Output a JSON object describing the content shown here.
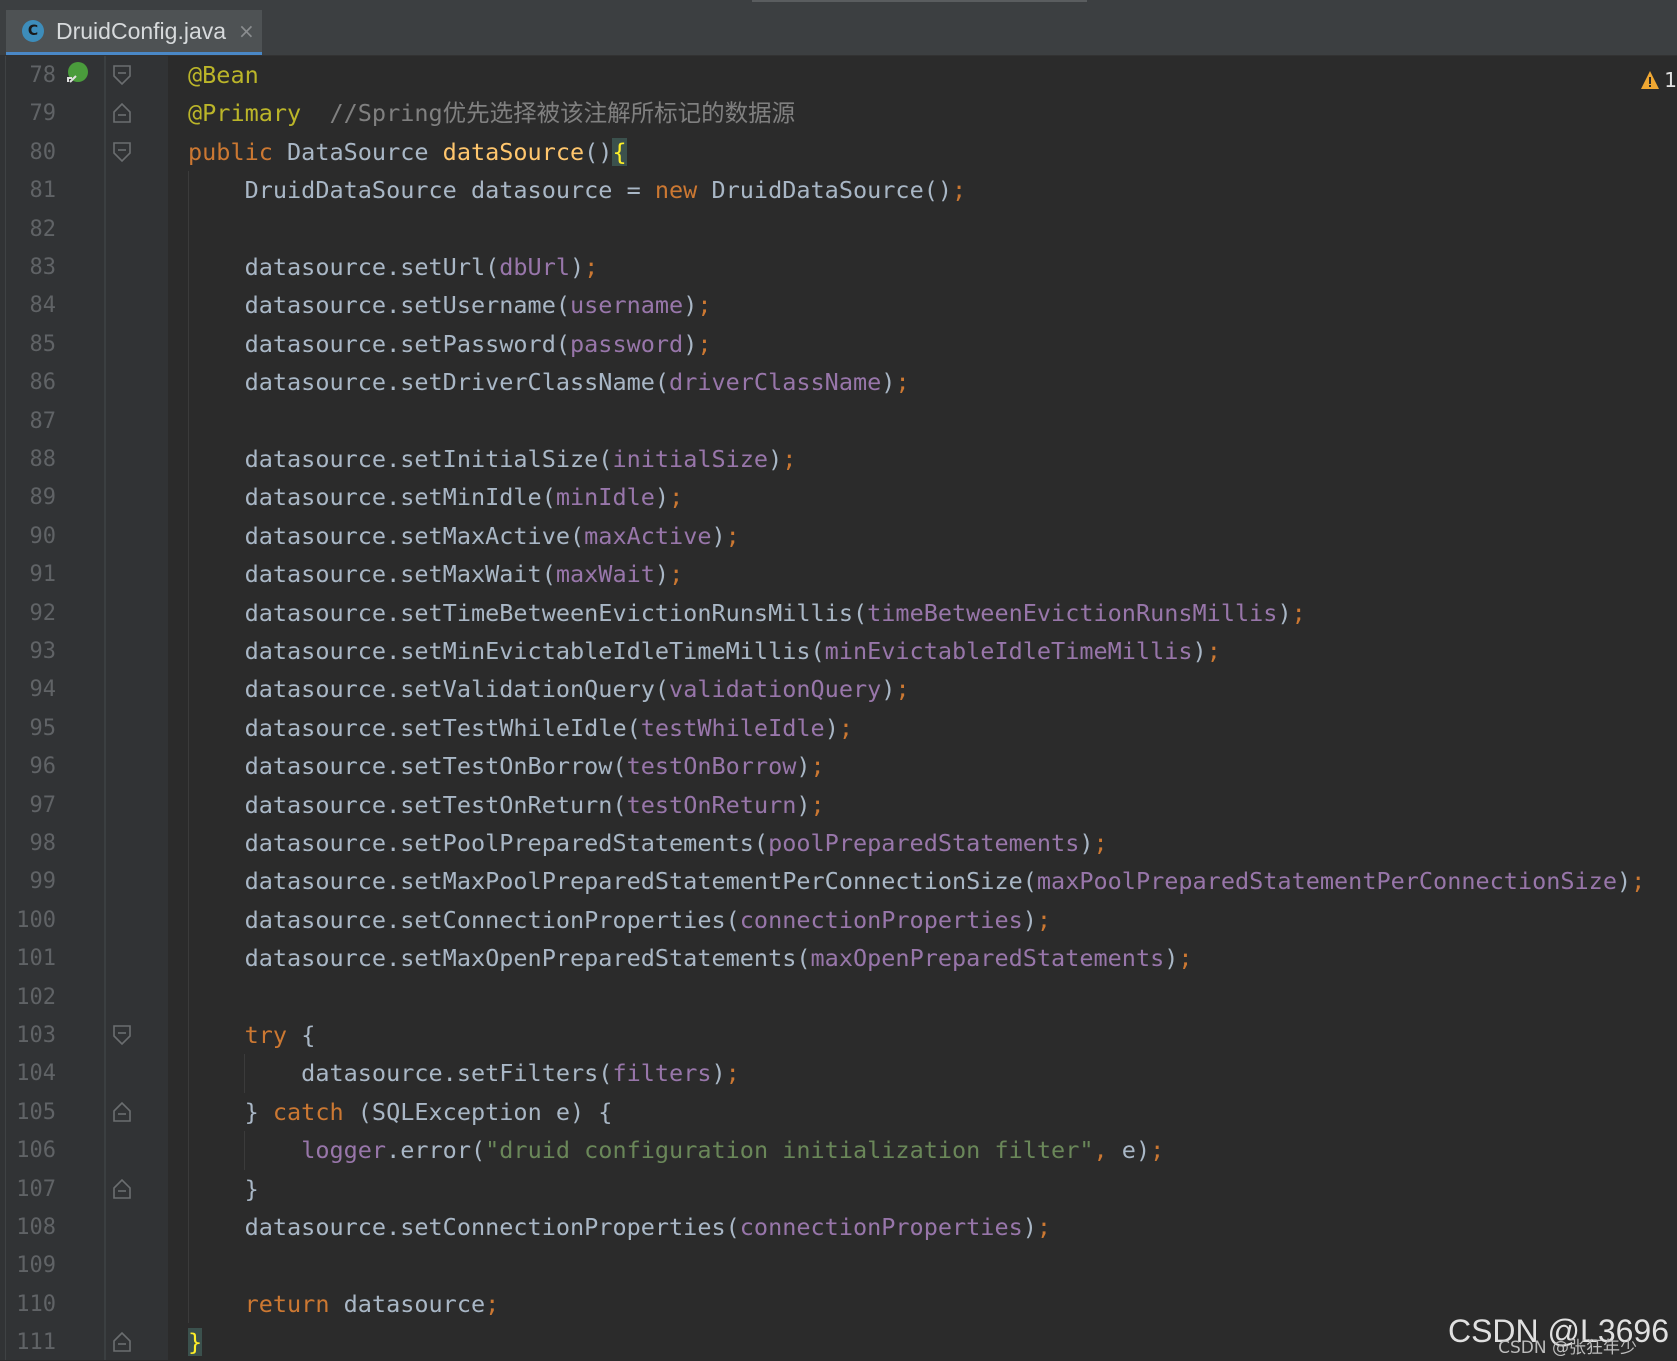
{
  "tab": {
    "icon": "class-icon",
    "icon_letter": "C",
    "title": "DruidConfig.java",
    "close": "×"
  },
  "warnings": {
    "count": "1"
  },
  "watermark": {
    "main": "CSDN @L3696",
    "sub": "CSDN @张狂年少"
  },
  "lines": [
    {
      "n": "78",
      "html": "<span class=\"a\">@Bean</span>"
    },
    {
      "n": "79",
      "html": "<span class=\"a\">@Primary</span>  <span class=\"c\">//Spring优先选择被该注解所标记的数据源</span>"
    },
    {
      "n": "80",
      "html": "<span class=\"k\">public</span> DataSource <span class=\"m\">dataSource</span>()<span class=\"brace\">{</span>"
    },
    {
      "n": "81",
      "html": "    DruidDataSource datasource = <span class=\"k\">new</span> DruidDataSource()<span class=\"k\">;</span>"
    },
    {
      "n": "82",
      "html": ""
    },
    {
      "n": "83",
      "html": "    datasource.setUrl(<span class=\"f\">dbUrl</span>)<span class=\"k\">;</span>"
    },
    {
      "n": "84",
      "html": "    datasource.setUsername(<span class=\"f\">username</span>)<span class=\"k\">;</span>"
    },
    {
      "n": "85",
      "html": "    datasource.setPassword(<span class=\"f\">password</span>)<span class=\"k\">;</span>"
    },
    {
      "n": "86",
      "html": "    datasource.setDriverClassName(<span class=\"f\">driverClassName</span>)<span class=\"k\">;</span>"
    },
    {
      "n": "87",
      "html": ""
    },
    {
      "n": "88",
      "html": "    datasource.setInitialSize(<span class=\"f\">initialSize</span>)<span class=\"k\">;</span>"
    },
    {
      "n": "89",
      "html": "    datasource.setMinIdle(<span class=\"f\">minIdle</span>)<span class=\"k\">;</span>"
    },
    {
      "n": "90",
      "html": "    datasource.setMaxActive(<span class=\"f\">maxActive</span>)<span class=\"k\">;</span>"
    },
    {
      "n": "91",
      "html": "    datasource.setMaxWait(<span class=\"f\">maxWait</span>)<span class=\"k\">;</span>"
    },
    {
      "n": "92",
      "html": "    datasource.setTimeBetweenEvictionRunsMillis(<span class=\"f\">timeBetweenEvictionRunsMillis</span>)<span class=\"k\">;</span>"
    },
    {
      "n": "93",
      "html": "    datasource.setMinEvictableIdleTimeMillis(<span class=\"f\">minEvictableIdleTimeMillis</span>)<span class=\"k\">;</span>"
    },
    {
      "n": "94",
      "html": "    datasource.setValidationQuery(<span class=\"f\">validationQuery</span>)<span class=\"k\">;</span>"
    },
    {
      "n": "95",
      "html": "    datasource.setTestWhileIdle(<span class=\"f\">testWhileIdle</span>)<span class=\"k\">;</span>"
    },
    {
      "n": "96",
      "html": "    datasource.setTestOnBorrow(<span class=\"f\">testOnBorrow</span>)<span class=\"k\">;</span>"
    },
    {
      "n": "97",
      "html": "    datasource.setTestOnReturn(<span class=\"f\">testOnReturn</span>)<span class=\"k\">;</span>"
    },
    {
      "n": "98",
      "html": "    datasource.setPoolPreparedStatements(<span class=\"f\">poolPreparedStatements</span>)<span class=\"k\">;</span>"
    },
    {
      "n": "99",
      "html": "    datasource.setMaxPoolPreparedStatementPerConnectionSize(<span class=\"f\">maxPoolPreparedStatementPerConnectionSize</span>)<span class=\"k\">;</span>"
    },
    {
      "n": "100",
      "html": "    datasource.setConnectionProperties(<span class=\"f\">connectionProperties</span>)<span class=\"k\">;</span>"
    },
    {
      "n": "101",
      "html": "    datasource.setMaxOpenPreparedStatements(<span class=\"f\">maxOpenPreparedStatements</span>)<span class=\"k\">;</span>"
    },
    {
      "n": "102",
      "html": ""
    },
    {
      "n": "103",
      "html": "    <span class=\"k\">try</span> {"
    },
    {
      "n": "104",
      "html": "        datasource.setFilters(<span class=\"f\">filters</span>)<span class=\"k\">;</span>"
    },
    {
      "n": "105",
      "html": "    } <span class=\"k\">catch</span> (SQLException e) {"
    },
    {
      "n": "106",
      "html": "        <span class=\"f\">logger</span>.error(<span class=\"s\">\"druid configuration initialization filter\"</span><span class=\"k\">,</span> e)<span class=\"k\">;</span>"
    },
    {
      "n": "107",
      "html": "    }"
    },
    {
      "n": "108",
      "html": "    datasource.setConnectionProperties(<span class=\"f\">connectionProperties</span>)<span class=\"k\">;</span>"
    },
    {
      "n": "109",
      "html": ""
    },
    {
      "n": "110",
      "html": "    <span class=\"k\">return</span> datasource<span class=\"k\">;</span>"
    },
    {
      "n": "111",
      "html": "<span class=\"brace\">}</span>"
    }
  ]
}
